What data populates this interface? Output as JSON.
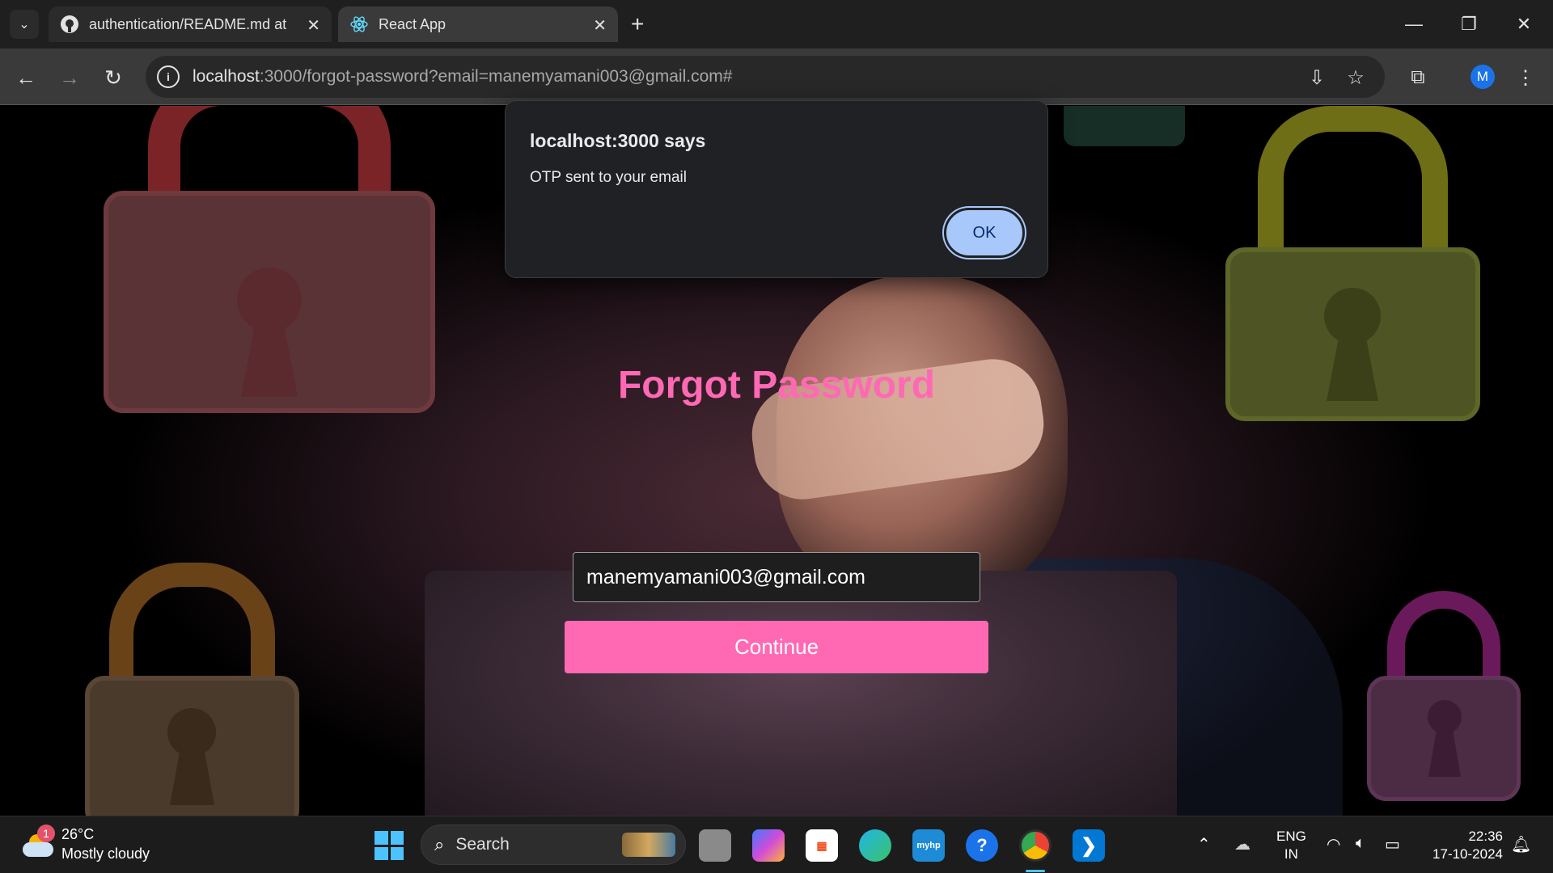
{
  "browser": {
    "tabs": [
      {
        "title": "authentication/README.md at m",
        "icon": "github-icon",
        "active": false
      },
      {
        "title": "React App",
        "icon": "react-icon",
        "active": true
      }
    ],
    "address": {
      "host": "localhost",
      "rest": ":3000/forgot-password?email=manemyamani003@gmail.com#"
    },
    "profile_initial": "M"
  },
  "alert": {
    "heading": "localhost:3000 says",
    "message": "OTP sent to your email",
    "ok_label": "OK"
  },
  "page": {
    "title": "Forgot Password",
    "email_value": "manemyamani003@gmail.com",
    "continue_label": "Continue",
    "accent_color": "#ff69b4"
  },
  "taskbar": {
    "weather": {
      "badge": "1",
      "temp": "26°C",
      "desc": "Mostly cloudy"
    },
    "search_label": "Search",
    "lang_line1": "ENG",
    "lang_line2": "IN",
    "time": "22:36",
    "date": "17-10-2024"
  }
}
